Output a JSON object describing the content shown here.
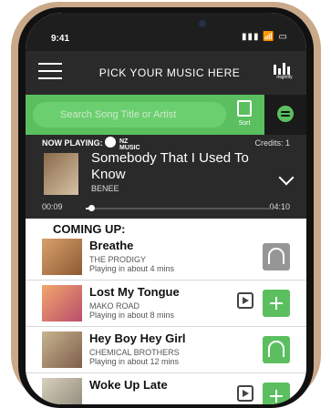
{
  "status_bar": {
    "time": "9:41",
    "icons_text": "▮▮▮ 📶 ▭"
  },
  "header": {
    "title": "PICK YOUR MUSIC HERE",
    "brand_label": "mightify",
    "menu_icon": "hamburger-icon",
    "brand_icon": "bars-brand-icon"
  },
  "search": {
    "placeholder": "Search Song Title or Artist",
    "clear_icon": "×",
    "sort_label": "Sort",
    "spotify_icon": "spotify-icon",
    "accent": "#5bbf5f"
  },
  "now_playing": {
    "label": "NOW PLAYING:",
    "nz_text": "NZ\nMUSIC",
    "credits": "Credits: 1",
    "song_title": "Somebody That I Used To Know",
    "artist": "BENEE",
    "elapsed": "00:09",
    "remaining": "04:10",
    "progress": 0.03
  },
  "coming_up": {
    "label": "COMING UP:"
  },
  "queue": [
    {
      "title": "Breathe",
      "artist": "THE PRODIGY",
      "time": "Playing in about 4 mins",
      "action": "headphones-grey",
      "nz": false
    },
    {
      "title": "Lost My Tongue",
      "artist": "MAKO ROAD",
      "time": "Playing in about 8 mins",
      "action": "plus-green",
      "nz": true
    },
    {
      "title": "Hey Boy Hey Girl",
      "artist": "CHEMICAL BROTHERS",
      "time": "Playing in about 12 mins",
      "action": "headphones-green",
      "nz": false
    },
    {
      "title": "Woke Up Late",
      "artist": "",
      "time": "",
      "action": "plus-green",
      "nz": true
    }
  ]
}
